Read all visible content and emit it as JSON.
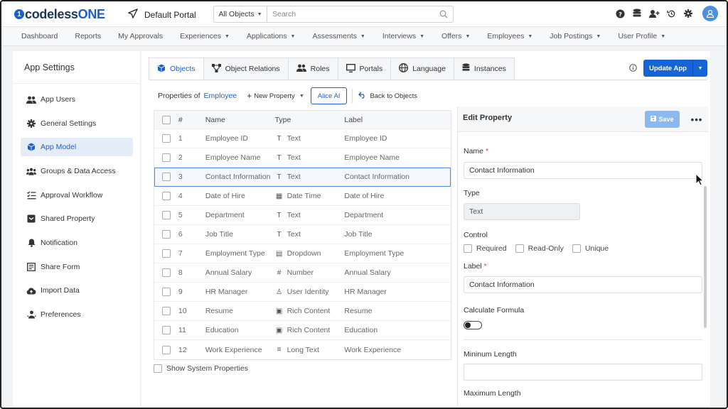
{
  "brand": {
    "mark": "1",
    "a": "codeless",
    "b": "ONE"
  },
  "portal": "Default Portal",
  "search": {
    "scope": "All Objects",
    "placeholder": "Search"
  },
  "nav": [
    {
      "label": "Dashboard",
      "dd": false
    },
    {
      "label": "Reports",
      "dd": false
    },
    {
      "label": "My Approvals",
      "dd": false
    },
    {
      "label": "Experiences",
      "dd": true
    },
    {
      "label": "Applications",
      "dd": true
    },
    {
      "label": "Assessments",
      "dd": true
    },
    {
      "label": "Interviews",
      "dd": true
    },
    {
      "label": "Offers",
      "dd": true
    },
    {
      "label": "Employees",
      "dd": true
    },
    {
      "label": "Job Postings",
      "dd": true
    },
    {
      "label": "User Profile",
      "dd": true
    }
  ],
  "sidebar": {
    "title": "App Settings",
    "items": [
      {
        "label": "App Users",
        "icon": "users-icon"
      },
      {
        "label": "General Settings",
        "icon": "gear-icon"
      },
      {
        "label": "App Model",
        "icon": "cube-icon"
      },
      {
        "label": "Groups & Data Access",
        "icon": "group-icon"
      },
      {
        "label": "Approval Workflow",
        "icon": "checklist-icon"
      },
      {
        "label": "Shared Property",
        "icon": "shared-icon"
      },
      {
        "label": "Notification",
        "icon": "bell-icon"
      },
      {
        "label": "Share Form",
        "icon": "form-icon"
      },
      {
        "label": "Import Data",
        "icon": "cloud-upload-icon"
      },
      {
        "label": "Preferences",
        "icon": "preferences-icon"
      }
    ]
  },
  "tabs": [
    "Objects",
    "Object Relations",
    "Roles",
    "Portals",
    "Language",
    "Instances"
  ],
  "update_btn": "Update App",
  "props": {
    "label": "Properties of",
    "object": "Employee",
    "new_prop": "New Property",
    "alice": "Alice AI",
    "back": "Back to Objects"
  },
  "table": {
    "headers": {
      "num": "#",
      "name": "Name",
      "type": "Type",
      "label": "Label"
    },
    "rows": [
      {
        "num": "1",
        "name": "Employee ID",
        "type": "Text",
        "ticon": "T",
        "label": "Employee ID"
      },
      {
        "num": "2",
        "name": "Employee Name",
        "type": "Text",
        "ticon": "T",
        "label": "Employee Name"
      },
      {
        "num": "3",
        "name": "Contact Information",
        "type": "Text",
        "ticon": "T",
        "label": "Contact Information"
      },
      {
        "num": "4",
        "name": "Date of Hire",
        "type": "Date Time",
        "ticon": "▦",
        "label": "Date of Hire"
      },
      {
        "num": "5",
        "name": "Department",
        "type": "Text",
        "ticon": "T",
        "label": "Department"
      },
      {
        "num": "6",
        "name": "Job Title",
        "type": "Text",
        "ticon": "T",
        "label": "Job Title"
      },
      {
        "num": "7",
        "name": "Employment Type",
        "type": "Dropdown",
        "ticon": "▤",
        "label": "Employment Type"
      },
      {
        "num": "8",
        "name": "Annual Salary",
        "type": "Number",
        "ticon": "#",
        "label": "Annual Salary"
      },
      {
        "num": "9",
        "name": "HR Manager",
        "type": "User Identity",
        "ticon": "♙",
        "label": "HR Manager"
      },
      {
        "num": "10",
        "name": "Resume",
        "type": "Rich Content",
        "ticon": "▣",
        "label": "Resume"
      },
      {
        "num": "11",
        "name": "Education",
        "type": "Rich Content",
        "ticon": "▣",
        "label": "Education"
      },
      {
        "num": "12",
        "name": "Work Experience",
        "type": "Long Text",
        "ticon": "≡",
        "label": "Work Experience"
      }
    ]
  },
  "show_system": "Show System Properties",
  "edit": {
    "title": "Edit Property",
    "save": "Save",
    "name_label": "Name",
    "name_value": "Contact Information",
    "type_label": "Type",
    "type_value": "Text",
    "control_label": "Control",
    "controls": [
      "Required",
      "Read-Only",
      "Unique"
    ],
    "label_label": "Label",
    "label_value": "Contact Information",
    "calc_label": "Calculate Formula",
    "min_label": "Mininum Length",
    "max_label": "Maximum Length"
  }
}
